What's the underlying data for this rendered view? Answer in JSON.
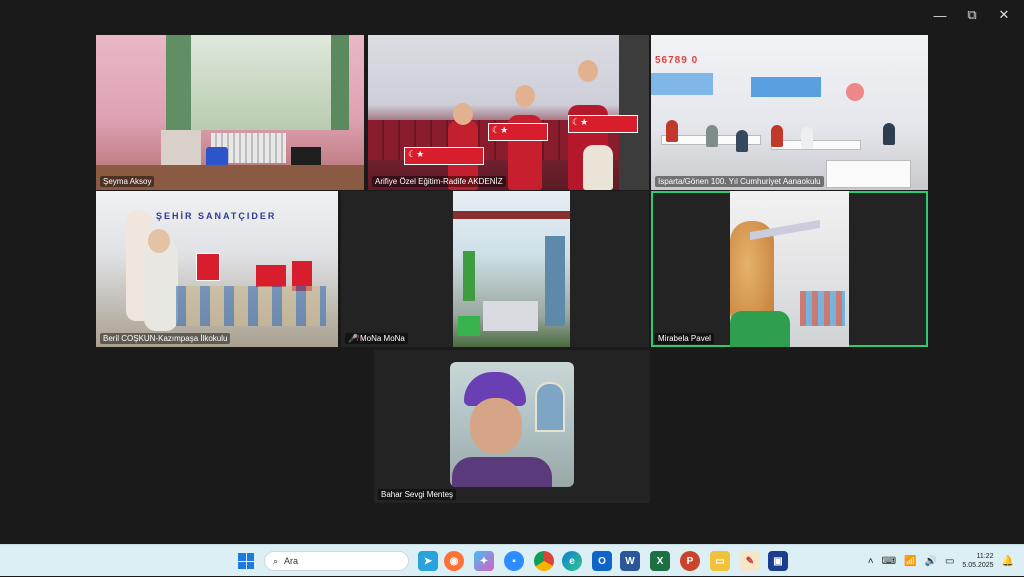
{
  "window": {
    "controls": {
      "minimize": "—",
      "restore": "⧉",
      "close": "✕"
    }
  },
  "participants": [
    {
      "name": "Şeyma Aksoy",
      "muted": false
    },
    {
      "name": "Arifiye Özel Eğitim-Radife AKDENİZ",
      "muted": false
    },
    {
      "name": "Isparta/Gönen 100. Yıl Cumhuriyet Aanaokulu",
      "muted": false
    },
    {
      "name": "Beril COŞKUN-Kazımpaşa İlkokulu",
      "muted": false
    },
    {
      "name": "MoNa MoNa",
      "muted": true
    },
    {
      "name": "Mirabela Pavel",
      "muted": false,
      "active_speaker": true
    },
    {
      "name": "Bahar Sevgi Menteş",
      "muted": false
    }
  ],
  "tile4_board_text": "ŞEHİR SANATÇIDER",
  "tile3_numbers": "56789 0",
  "taskbar": {
    "search_placeholder": "Ara",
    "icons": [
      "telegram-icon",
      "firefox-icon",
      "copilot-icon",
      "zoom-icon",
      "chrome-icon",
      "edge-icon",
      "outlook-icon",
      "word-icon",
      "excel-icon",
      "powerpoint-icon",
      "file-explorer-icon",
      "paint-icon",
      "store-icon"
    ],
    "time": "11:22",
    "date": "5.05.2025"
  },
  "colors": {
    "active_speaker_border": "#2ecc71",
    "taskbar_bg": "#dceff5",
    "meeting_bg": "#1a1a1a"
  }
}
